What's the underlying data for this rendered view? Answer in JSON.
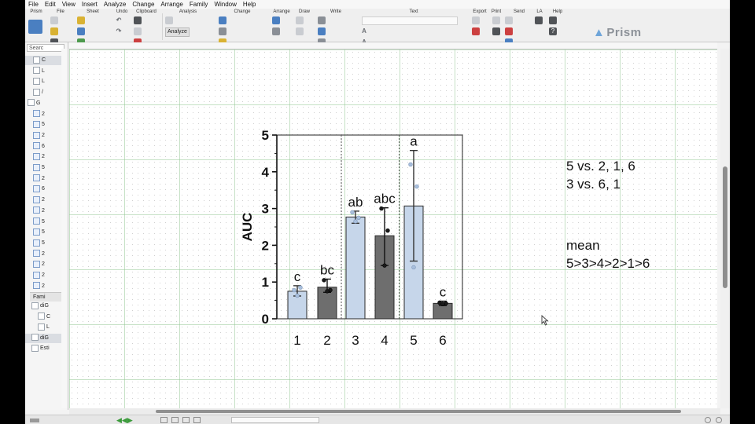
{
  "menu": {
    "items": [
      "File",
      "Edit",
      "View",
      "Insert",
      "Analyze",
      "Change",
      "Arrange",
      "Family",
      "Window",
      "Help"
    ]
  },
  "ribbon": {
    "groups": [
      "Prism",
      "File",
      "Sheet",
      "Undo",
      "Clipboard",
      "Analysis",
      "Change",
      "Arrange",
      "Draw",
      "Write",
      "Text",
      "Export",
      "Print",
      "Send",
      "LA",
      "Help"
    ],
    "analyze_label": "Analyze",
    "logo_text": "Prism"
  },
  "navigator": {
    "search_placeholder": "Searc",
    "rows": [
      "C",
      "L",
      "L",
      "/",
      "G",
      "2",
      "5",
      "2",
      "6",
      "2",
      "5",
      "2",
      "6",
      "2",
      "2",
      "5",
      "5",
      "5",
      "2",
      "2",
      "2",
      "2"
    ],
    "family_label": "Fami",
    "family_rows": [
      "diG",
      "C",
      "L",
      "diG",
      "Esti"
    ]
  },
  "chart_data": {
    "type": "bar",
    "categories": [
      "1",
      "2",
      "3",
      "4",
      "5",
      "6"
    ],
    "values": [
      0.75,
      0.86,
      2.77,
      2.26,
      3.07,
      0.42
    ],
    "errors_low": [
      0.62,
      0.72,
      2.6,
      1.45,
      1.57,
      0.36
    ],
    "errors_high": [
      0.9,
      1.08,
      2.93,
      3.02,
      4.58,
      0.48
    ],
    "points": [
      [
        0.78,
        0.85,
        0.63
      ],
      [
        1.05,
        0.78,
        0.75
      ],
      [
        2.9,
        2.75,
        2.65
      ],
      [
        3.0,
        2.4,
        1.45
      ],
      [
        4.2,
        3.6,
        1.4
      ],
      [
        0.44,
        0.42,
        0.4
      ]
    ],
    "bar_colors": [
      "#c6d6ea",
      "#6e6e6e",
      "#c6d6ea",
      "#6e6e6e",
      "#c6d6ea",
      "#6e6e6e"
    ],
    "letters": [
      "c",
      "bc",
      "ab",
      "abc",
      "a",
      "c"
    ],
    "ylabel": "AUC",
    "ylim": [
      0,
      5
    ],
    "yticks": [
      "0",
      "1",
      "2",
      "3",
      "4",
      "5"
    ],
    "dividers_after": [
      2,
      4
    ]
  },
  "notes": {
    "compare_line1": "5 vs. 2,  1,   6",
    "compare_line2": "3 vs. 6,  1",
    "mean_line1": "mean",
    "mean_line2": "5>3>4>2>1>6"
  },
  "colors": {
    "light_bar": "#c6d6ea",
    "dark_bar": "#6e6e6e",
    "grid": "#96c896"
  }
}
